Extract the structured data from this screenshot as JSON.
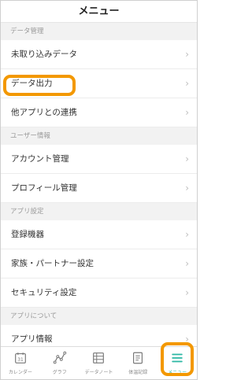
{
  "header": {
    "title": "メニュー"
  },
  "sections": [
    {
      "label": "データ管理",
      "items": [
        {
          "label": "未取り込みデータ"
        },
        {
          "label": "データ出力"
        },
        {
          "label": "他アプリとの連携"
        }
      ]
    },
    {
      "label": "ユーザー情報",
      "items": [
        {
          "label": "アカウント管理"
        },
        {
          "label": "プロフィール管理"
        }
      ]
    },
    {
      "label": "アプリ設定",
      "items": [
        {
          "label": "登録機器"
        },
        {
          "label": "家族・パートナー設定"
        },
        {
          "label": "セキュリティ設定"
        }
      ]
    },
    {
      "label": "アプリについて",
      "items": [
        {
          "label": "アプリ情報"
        }
      ]
    }
  ],
  "chevron": "›",
  "tabs": [
    {
      "label": "カレンダー",
      "icon": "calendar-icon",
      "date": "31"
    },
    {
      "label": "グラフ",
      "icon": "graph-icon"
    },
    {
      "label": "データノート",
      "icon": "data-note-icon"
    },
    {
      "label": "体温記録",
      "icon": "temperature-record-icon"
    },
    {
      "label": "メニュー",
      "icon": "menu-icon"
    }
  ],
  "colors": {
    "highlight": "#f39800",
    "accent": "#2ab6a3",
    "section_bg": "#f2f2f2"
  }
}
